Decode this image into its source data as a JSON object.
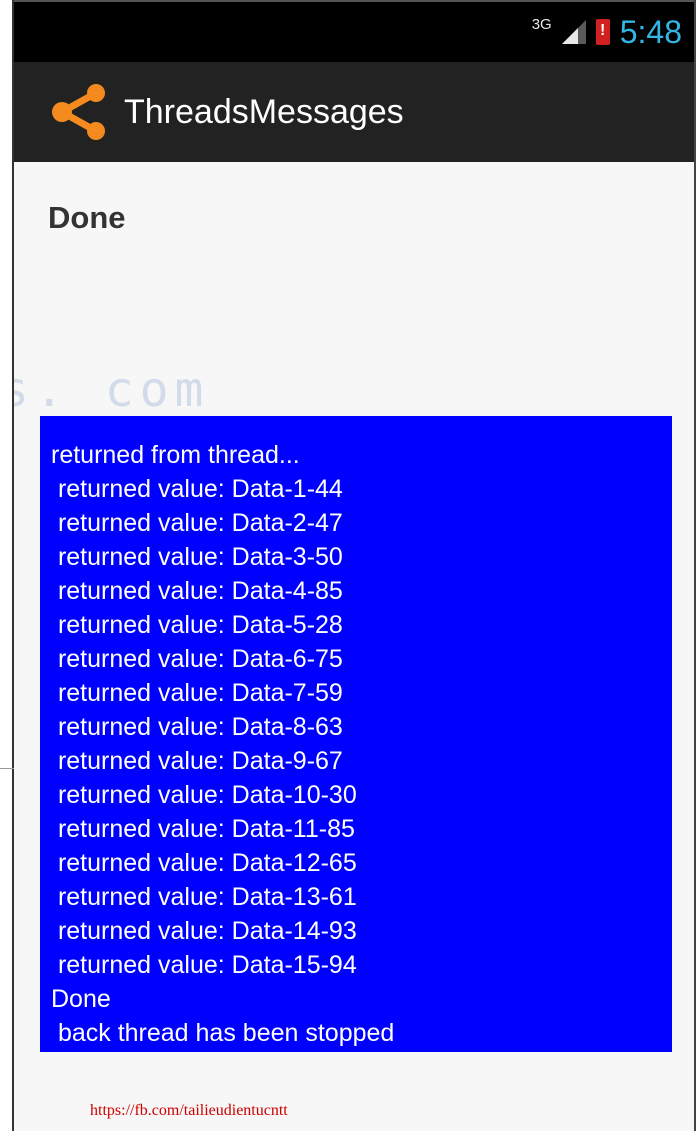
{
  "status_bar": {
    "network": "3G",
    "time": "5:48",
    "icons": [
      "signal-icon",
      "battery-alert-icon"
    ],
    "clock_color": "#33b5e5"
  },
  "action_bar": {
    "app_icon": "share-icon",
    "title": "ThreadsMessages",
    "accent_color": "#f58a1f"
  },
  "main": {
    "status_text": "Done",
    "log_background": "#0000ff",
    "log_lines": [
      "returned from thread...",
      " returned value: Data-1-44",
      " returned value: Data-2-47",
      " returned value: Data-3-50",
      " returned value: Data-4-85",
      " returned value: Data-5-28",
      " returned value: Data-6-75",
      " returned value: Data-7-59",
      " returned value: Data-8-63",
      " returned value: Data-9-67",
      " returned value: Data-10-30",
      " returned value: Data-11-85",
      " returned value: Data-12-65",
      " returned value: Data-13-61",
      " returned value: Data-14-93",
      " returned value: Data-15-94",
      "Done",
      " back thread has been stopped"
    ]
  },
  "watermark": {
    "text": "s. com"
  },
  "footer": {
    "link_text": "https://fb.com/tailieudientucntt"
  }
}
